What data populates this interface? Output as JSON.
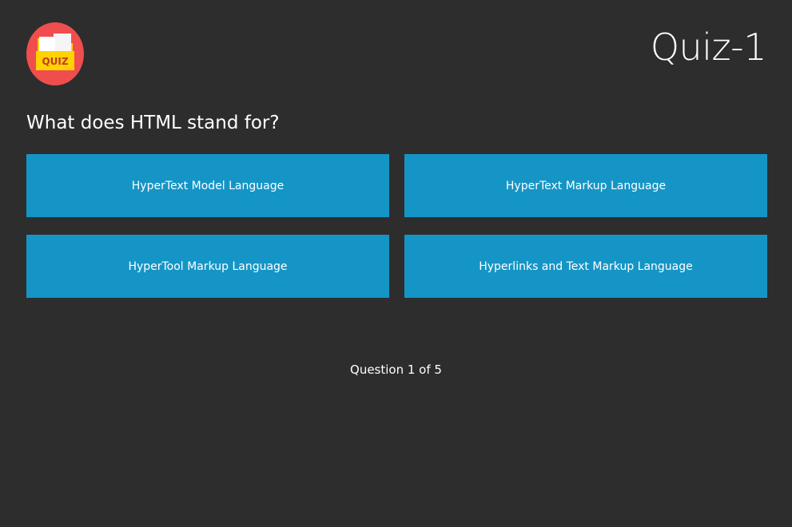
{
  "header": {
    "logo_text": "QUIZ",
    "title": "Quiz-1"
  },
  "question": {
    "text": "What does HTML stand for?"
  },
  "options": [
    {
      "label": "HyperText Model Language"
    },
    {
      "label": "HyperText Markup Language"
    },
    {
      "label": "HyperTool Markup Language"
    },
    {
      "label": "Hyperlinks and Text Markup Language"
    }
  ],
  "progress": {
    "text": "Question 1 of 5"
  },
  "colors": {
    "background": "#2d2d2d",
    "option_bg": "#1595c6",
    "logo_circle": "#f04e4e",
    "logo_folder": "#ffd200"
  }
}
